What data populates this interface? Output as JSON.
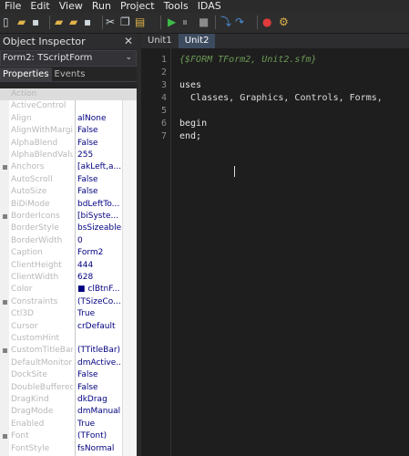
{
  "menu": [
    "File",
    "Edit",
    "View",
    "Run",
    "Project",
    "Tools",
    "IDAS"
  ],
  "toolbar_icons": [
    {
      "name": "new-file-icon",
      "color": "#cfd8dc"
    },
    {
      "name": "open-folder-icon",
      "color": "#e0b34a"
    },
    {
      "name": "save-icon",
      "color": "#cfd8dc"
    },
    {
      "name": "open-project-icon",
      "color": "#e0b34a"
    },
    {
      "name": "new-folder-icon",
      "color": "#e0b34a"
    },
    {
      "name": "save-all-icon",
      "color": "#cfd8dc"
    },
    {
      "name": "cut-icon",
      "color": "#cfd8dc"
    },
    {
      "name": "copy-icon",
      "color": "#cfd8dc"
    },
    {
      "name": "paste-icon",
      "color": "#e0b34a"
    },
    {
      "name": "run-icon",
      "color": "#3dbb4a"
    },
    {
      "name": "pause-icon",
      "color": "#8a8a8a"
    },
    {
      "name": "stop-icon",
      "color": "#8a8a8a"
    },
    {
      "name": "step-into-icon",
      "color": "#4a90d9"
    },
    {
      "name": "step-over-icon",
      "color": "#4a90d9"
    },
    {
      "name": "breakpoint-icon",
      "color": "#e03b3b"
    },
    {
      "name": "debug-settings-icon",
      "color": "#e0b34a"
    }
  ],
  "inspector": {
    "title": "Object Inspector",
    "form_selector": "Form2: TScriptForm",
    "tabs": [
      "Properties",
      "Events"
    ],
    "properties": [
      {
        "name": "Action",
        "value": "",
        "selected": true,
        "marker": false
      },
      {
        "name": "ActiveControl",
        "value": "",
        "marker": false
      },
      {
        "name": "Align",
        "value": "alNone",
        "marker": false
      },
      {
        "name": "AlignWithMargins",
        "value": "False",
        "marker": false
      },
      {
        "name": "AlphaBlend",
        "value": "False",
        "marker": false
      },
      {
        "name": "AlphaBlendValue",
        "value": "255",
        "marker": false
      },
      {
        "name": "Anchors",
        "value": "[akLeft,a...",
        "marker": true
      },
      {
        "name": "AutoScroll",
        "value": "False",
        "marker": false
      },
      {
        "name": "AutoSize",
        "value": "False",
        "marker": false
      },
      {
        "name": "BiDiMode",
        "value": "bdLeftTo...",
        "marker": false
      },
      {
        "name": "BorderIcons",
        "value": "[biSyste...",
        "marker": true
      },
      {
        "name": "BorderStyle",
        "value": "bsSizeable",
        "marker": false
      },
      {
        "name": "BorderWidth",
        "value": "0",
        "marker": false
      },
      {
        "name": "Caption",
        "value": "Form2",
        "marker": false
      },
      {
        "name": "ClientHeight",
        "value": "444",
        "marker": false
      },
      {
        "name": "ClientWidth",
        "value": "628",
        "marker": false
      },
      {
        "name": "Color",
        "value": "■ clBtnF...",
        "marker": false
      },
      {
        "name": "Constraints",
        "value": "(TSizeCo...",
        "marker": true
      },
      {
        "name": "Ctl3D",
        "value": "True",
        "marker": false
      },
      {
        "name": "Cursor",
        "value": "crDefault",
        "marker": false
      },
      {
        "name": "CustomHint",
        "value": "",
        "marker": false
      },
      {
        "name": "CustomTitleBar",
        "value": "(TTitleBar)",
        "marker": true
      },
      {
        "name": "DefaultMonitor",
        "value": "dmActive...",
        "marker": false
      },
      {
        "name": "DockSite",
        "value": "False",
        "marker": false
      },
      {
        "name": "DoubleBuffered",
        "value": "False",
        "marker": false
      },
      {
        "name": "DragKind",
        "value": "dkDrag",
        "marker": false
      },
      {
        "name": "DragMode",
        "value": "dmManual",
        "marker": false
      },
      {
        "name": "Enabled",
        "value": "True",
        "marker": false
      },
      {
        "name": "Font",
        "value": "(TFont)",
        "marker": true
      },
      {
        "name": "FontStyle",
        "value": "fsNormal",
        "marker": false
      }
    ]
  },
  "editor": {
    "tabs": [
      "Unit1",
      "Unit2"
    ],
    "active_tab": "Unit2",
    "lines": [
      {
        "num": "1",
        "text": "{$FORM TForm2, Unit2.sfm}",
        "kind": "directive"
      },
      {
        "num": "2",
        "text": "",
        "kind": "plain"
      },
      {
        "num": "3",
        "text": "uses",
        "kind": "keyword"
      },
      {
        "num": "4",
        "text": "  Classes, Graphics, Controls, Forms,",
        "kind": "plain"
      },
      {
        "num": "5",
        "text": "",
        "kind": "plain"
      },
      {
        "num": "6",
        "text": "begin",
        "kind": "keyword"
      },
      {
        "num": "7",
        "text": "end;",
        "kind": "keyword"
      }
    ]
  }
}
